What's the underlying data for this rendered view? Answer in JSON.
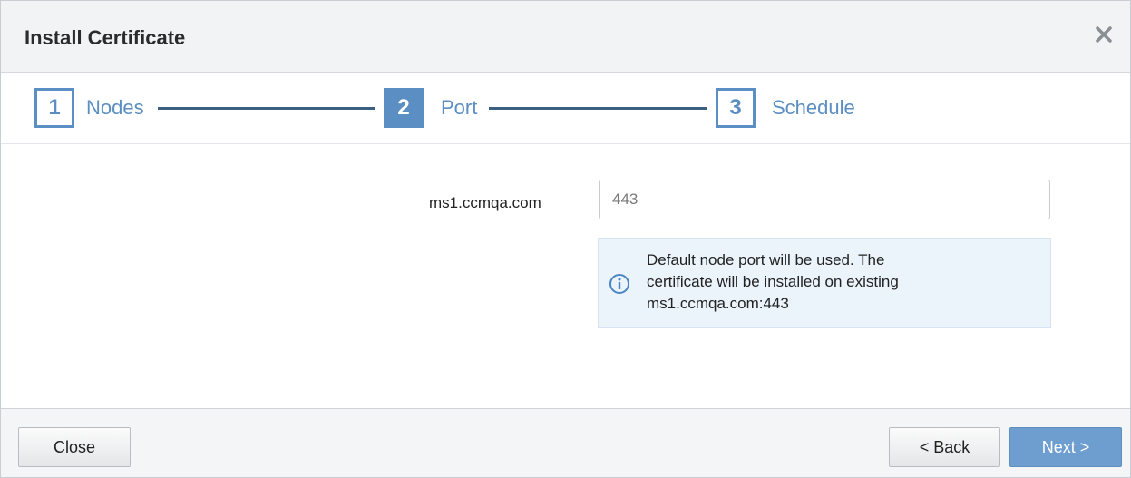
{
  "dialog": {
    "title": "Install Certificate",
    "close_icon": "close-icon"
  },
  "wizard": {
    "steps": [
      {
        "number": "1",
        "label": "Nodes",
        "state": "visited"
      },
      {
        "number": "2",
        "label": "Port",
        "state": "active"
      },
      {
        "number": "3",
        "label": "Schedule",
        "state": "upcoming"
      }
    ],
    "accent_color": "#5b8ec2"
  },
  "form": {
    "node_label": "ms1.ccmqa.com",
    "port_value": "443",
    "info_icon": "info-icon",
    "info_lines": [
      "Default node port will be used. The",
      "certificate will be installed on existing",
      "ms1.ccmqa.com:443"
    ]
  },
  "footer": {
    "close_label": "Close",
    "back_label": "< Back",
    "next_label": "Next >"
  }
}
